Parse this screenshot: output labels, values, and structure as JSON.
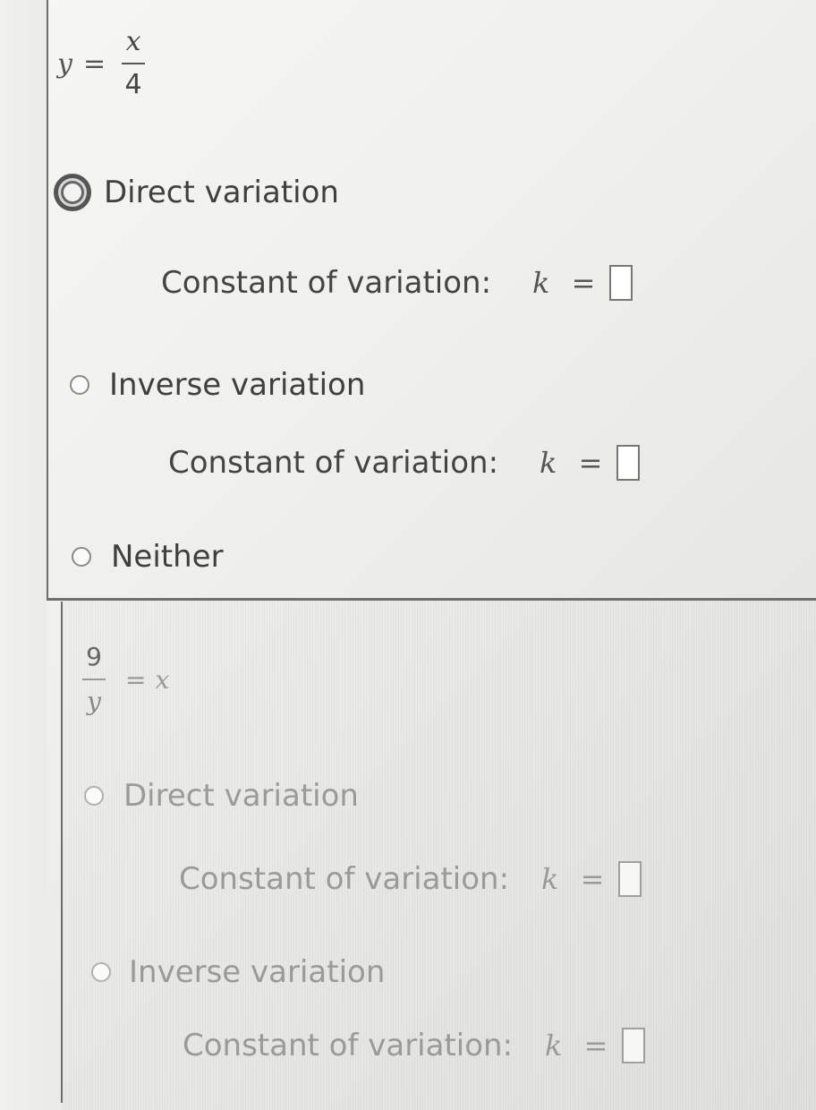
{
  "problem_1": {
    "equation": {
      "lhs": "y",
      "equals": "=",
      "numerator": "x",
      "denominator": "4"
    },
    "options": [
      {
        "label": "Direct variation",
        "selected": true
      },
      {
        "label": "Inverse variation",
        "selected": false
      },
      {
        "label": "Neither",
        "selected": false
      }
    ],
    "constant_label": "Constant of variation:",
    "k_symbol": "k",
    "k_equals": "=",
    "direct_k_value": "",
    "inverse_k_value": ""
  },
  "problem_2": {
    "equation": {
      "numerator": "9",
      "denominator": "y",
      "equals": "=",
      "rhs": "x"
    },
    "options": [
      {
        "label": "Direct variation",
        "selected": false
      },
      {
        "label": "Inverse variation",
        "selected": false
      }
    ],
    "constant_label": "Constant of variation:",
    "k_symbol": "k",
    "k_equals": "=",
    "direct_k_value": "",
    "inverse_k_value": ""
  }
}
